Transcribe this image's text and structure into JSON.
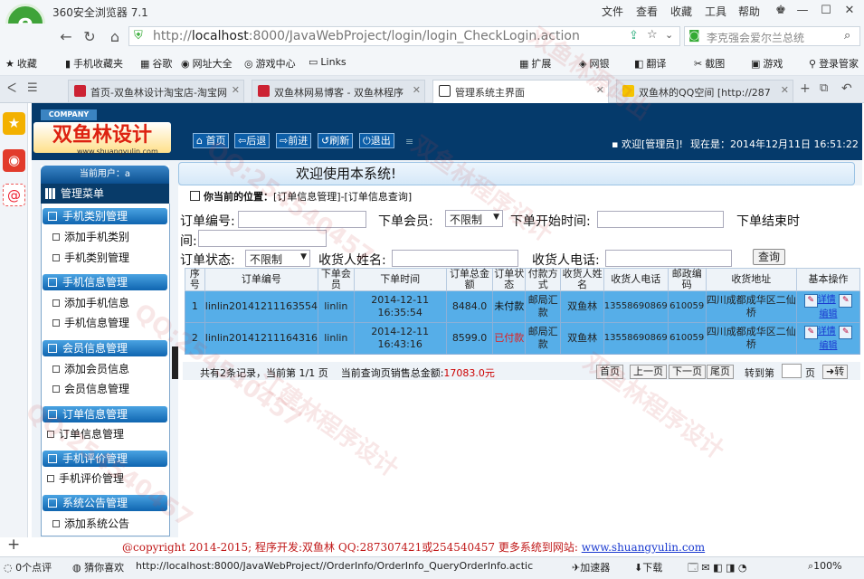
{
  "browser": {
    "title": "360安全浏览器 7.1",
    "menus": [
      "文件",
      "查看",
      "收藏",
      "工具",
      "帮助"
    ],
    "url_host": "localhost",
    "url_rest": ":8000/JavaWebProject/login/login_CheckLogin.action",
    "url_prefix": "http://",
    "search_text": "李克强会爱尔兰总统",
    "favorites": [
      "收藏",
      "手机收藏夹",
      "谷歌",
      "网址大全",
      "游戏中心",
      "Links"
    ],
    "extras": [
      "扩展",
      "网银",
      "翻译",
      "截图",
      "游戏",
      "登录管家"
    ],
    "tabs": [
      {
        "label": "首页-双鱼林设计淘宝店-淘宝网"
      },
      {
        "label": "双鱼林网易博客 - 双鱼林程序"
      },
      {
        "label": "管理系统主界面"
      },
      {
        "label": "双鱼林的QQ空间 [http://287"
      }
    ]
  },
  "app": {
    "company": "COMPANY",
    "brand": "双鱼林设计",
    "brand_url": "www.shuangyulin.com",
    "toolbar": [
      "首页",
      "后退",
      "前进",
      "刷新",
      "退出"
    ],
    "welcome_user": "欢迎[管理员]!",
    "now_label": "现在是：",
    "now_value": "2014年12月11日 16:51:22",
    "banner": "欢迎使用本系统!",
    "current_user": "当前用户：a",
    "menu_title": "管理菜单"
  },
  "menu": [
    {
      "title": "手机类别管理",
      "items": [
        "添加手机类别",
        "手机类别管理"
      ]
    },
    {
      "title": "手机信息管理",
      "items": [
        "添加手机信息",
        "手机信息管理"
      ]
    },
    {
      "title": "会员信息管理",
      "items": [
        "添加会员信息",
        "会员信息管理"
      ]
    },
    {
      "title": "订单信息管理",
      "items": [
        "订单信息管理"
      ]
    },
    {
      "title": "手机评价管理",
      "items": [
        "手机评价管理"
      ]
    },
    {
      "title": "系统公告管理",
      "items": [
        "添加系统公告"
      ]
    }
  ],
  "location": {
    "label": "你当前的位置：",
    "path": "[订单信息管理]-[订单信息查询]"
  },
  "form": {
    "order_no_label": "订单编号:",
    "member_label": "下单会员:",
    "member_value": "不限制",
    "start_label": "下单开始时间:",
    "end_label": "下单结束时",
    "end_label2": "间:",
    "state_label": "订单状态:",
    "state_value": "不限制",
    "receiver_label": "收货人姓名:",
    "phone_label": "收货人电话:",
    "query_label": "查询"
  },
  "table": {
    "headers": [
      "序号",
      "订单编号",
      "下单会员",
      "下单时间",
      "订单总金额",
      "订单状态",
      "付款方式",
      "收货人姓名",
      "收货人电话",
      "邮政编码",
      "收货地址",
      "基本操作"
    ],
    "rows": [
      {
        "idx": "1",
        "no": "linlin20141211163554",
        "member": "linlin",
        "date": "2014-12-11",
        "time": "16:35:54",
        "amount": "8484.0",
        "state": "未付款",
        "pay": "邮局汇款",
        "receiver": "双鱼林",
        "phone": "13558690869",
        "zip": "610059",
        "addr": "四川成都成华区二仙桥",
        "op_detail": "详情",
        "op_edit": "编辑"
      },
      {
        "idx": "2",
        "no": "linlin20141211164316",
        "member": "linlin",
        "date": "2014-12-11",
        "time": "16:43:16",
        "amount": "8599.0",
        "state": "已付款",
        "pay": "邮局汇款",
        "receiver": "双鱼林",
        "phone": "13558690869",
        "zip": "610059",
        "addr": "四川成都成华区二仙桥",
        "op_detail": "详情",
        "op_edit": "编辑"
      }
    ]
  },
  "pager": {
    "summary": "共有2条记录，当前第 1/1 页",
    "total_label": "当前查询页销售总金额:",
    "total_value": "17083.0元",
    "buttons": [
      "首页",
      "上一页",
      "下一页",
      "尾页"
    ],
    "jump_label": "转到第",
    "page_unit": "页",
    "go": "转"
  },
  "footer": {
    "text": "@copyright 2014-2015; 程序开发:双鱼林  QQ:287307421或254540457  更多系统到网站:",
    "url": "www.shuangyulin.com"
  },
  "status": {
    "left": "0个点评",
    "guess": "猜你喜欢",
    "link": "http://localhost:8000/JavaWebProject//OrderInfo/OrderInfo_QueryOrderInfo.actic",
    "accelerator": "加速器",
    "download": "下载",
    "zoom": "100%"
  },
  "watermarks": [
    "江建林程序设计",
    "QQ:254540457",
    "双鱼林源码出",
    "双鱼林程序设计"
  ]
}
